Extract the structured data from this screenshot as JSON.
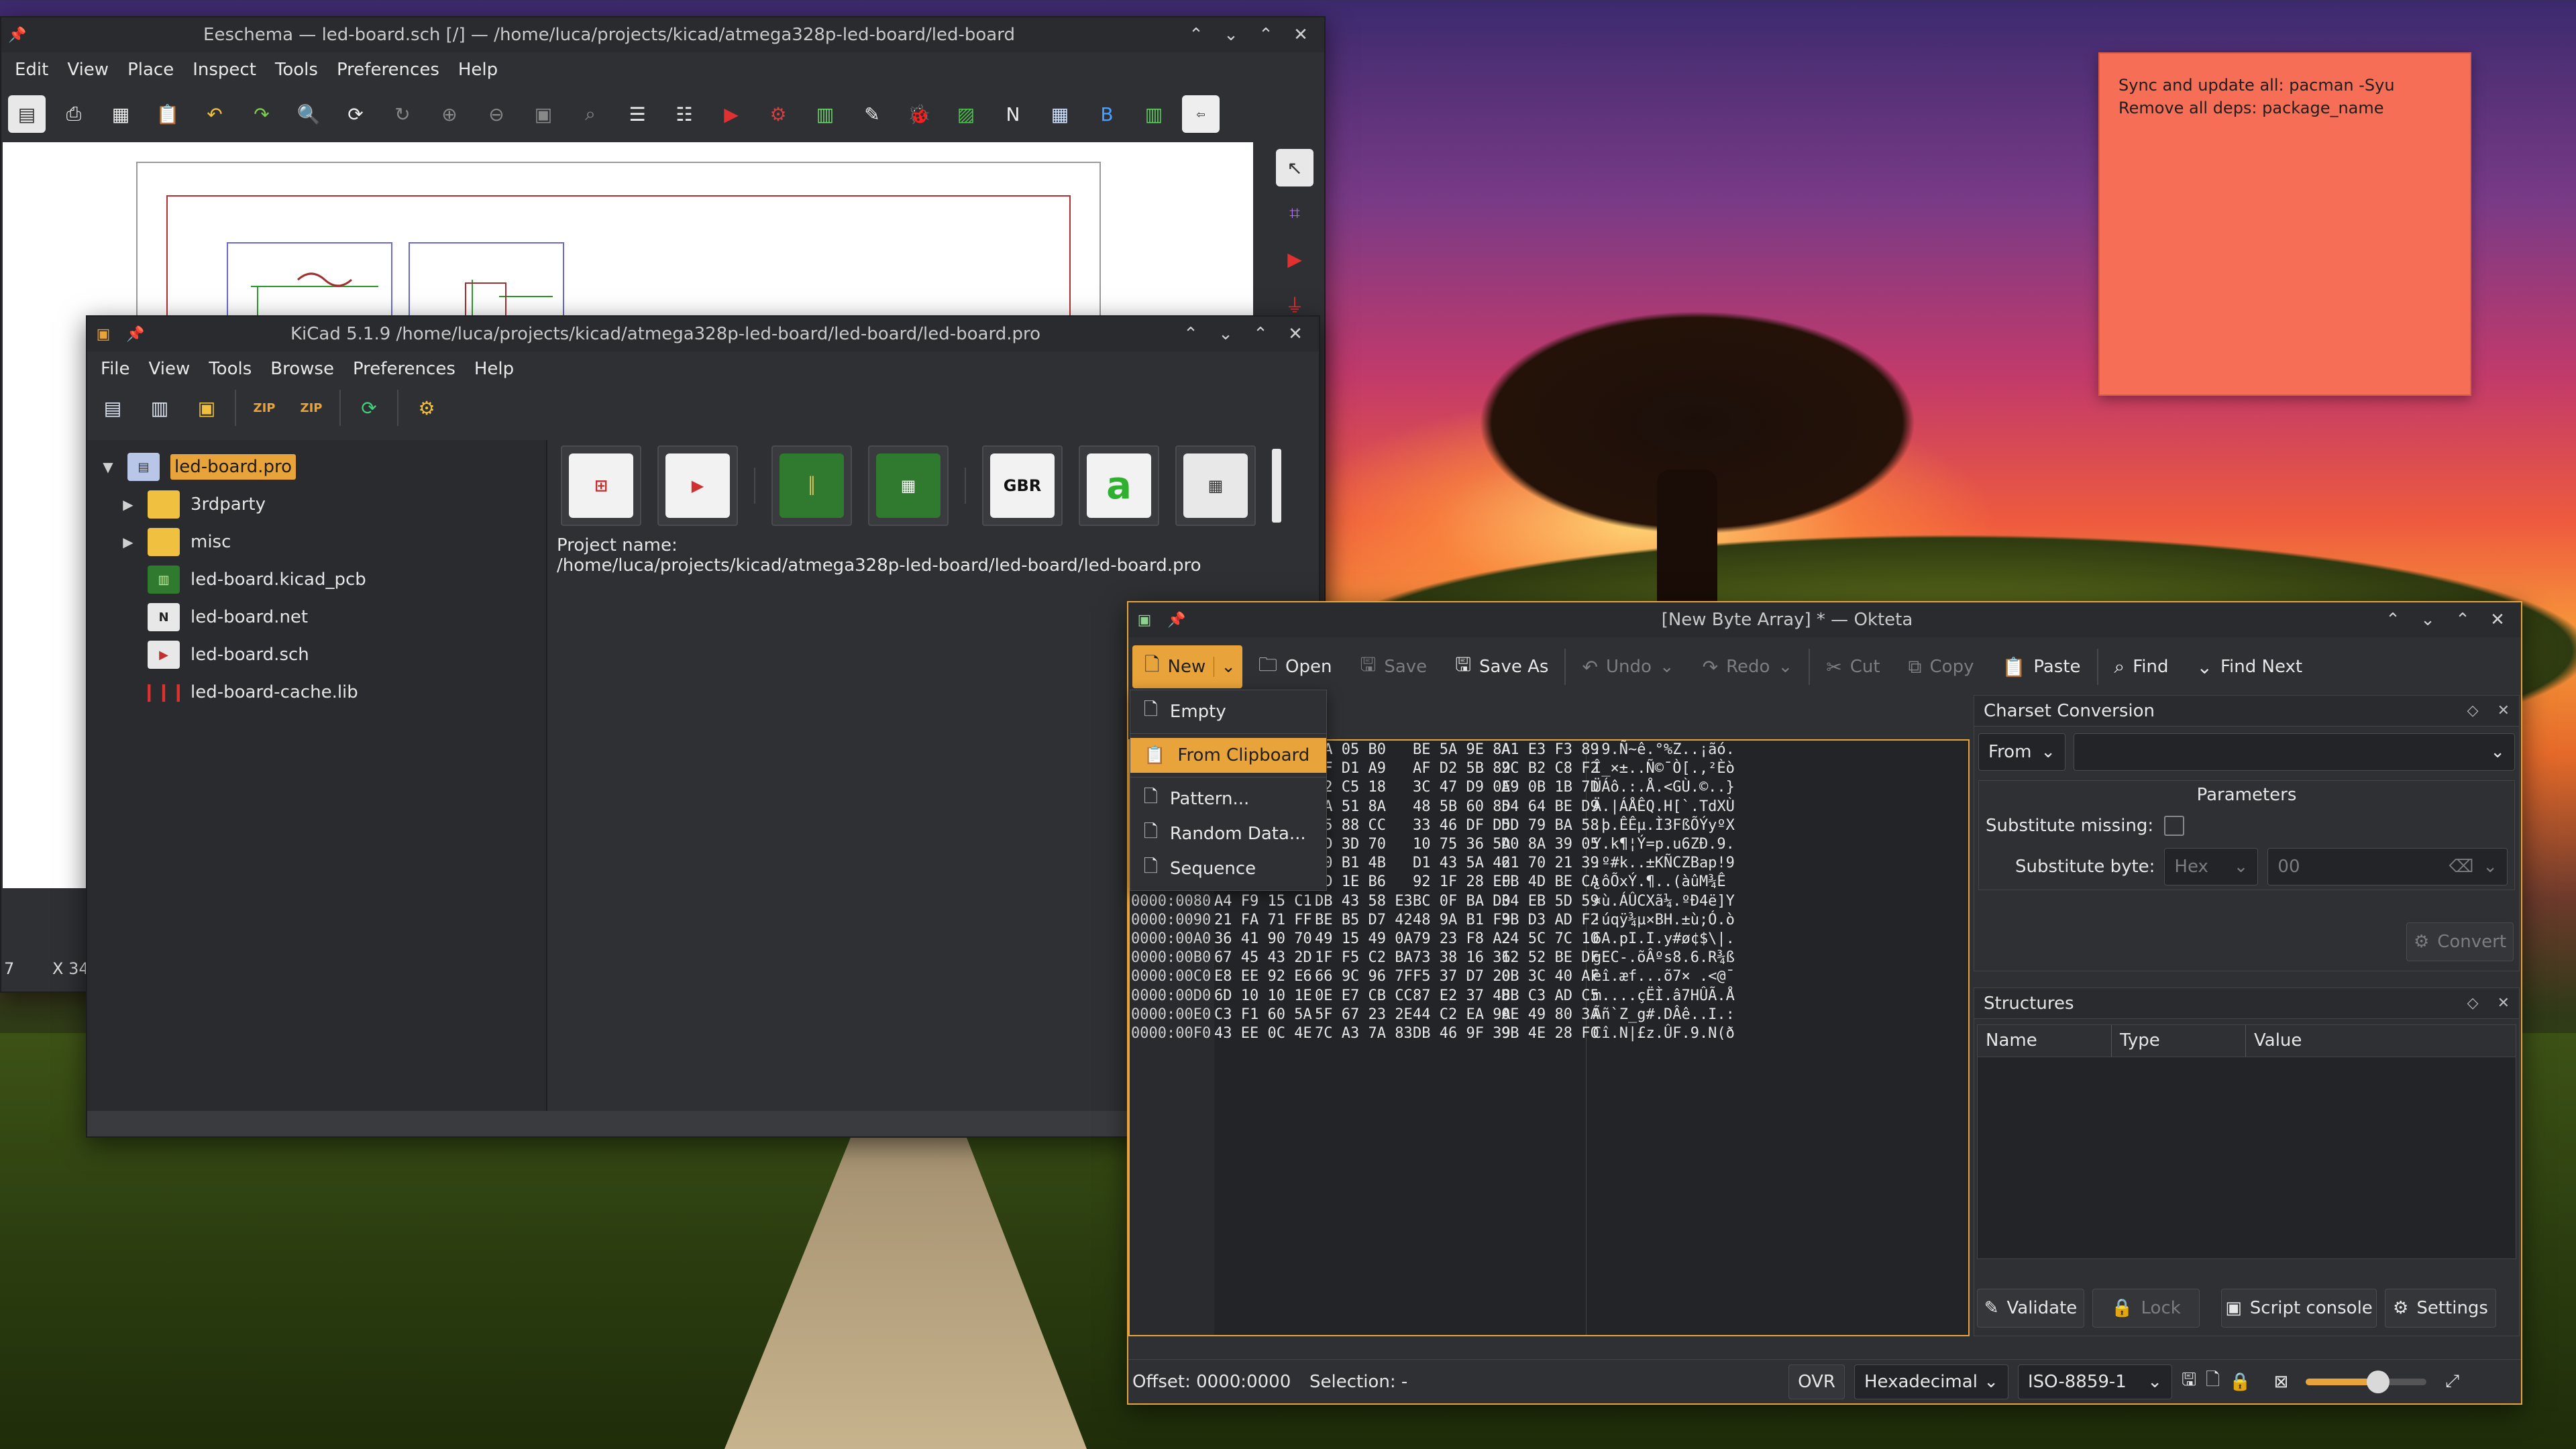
{
  "sticky_note": {
    "line1": "Sync and update all: pacman -Syu",
    "line2": "Remove all deps:  package_name"
  },
  "eeschema": {
    "title": "Eeschema — led-board.sch [/] — /home/luca/projects/kicad/atmega328p-led-board/led-board",
    "menu": [
      "Edit",
      "View",
      "Place",
      "Inspect",
      "Tools",
      "Preferences",
      "Help"
    ],
    "status_left": "7",
    "status_x": "X 34"
  },
  "kicad": {
    "title": "KiCad 5.1.9 /home/luca/projects/kicad/atmega328p-led-board/led-board/led-board.pro",
    "menu": [
      "File",
      "View",
      "Tools",
      "Browse",
      "Preferences",
      "Help"
    ],
    "tree": {
      "root": "led-board.pro",
      "items": [
        "3rdparty",
        "misc",
        "led-board.kicad_pcb",
        "led-board.net",
        "led-board.sch",
        "led-board-cache.lib"
      ]
    },
    "project_name_label": "Project name:",
    "project_path": "/home/luca/projects/kicad/atmega328p-led-board/led-board/led-board.pro"
  },
  "okteta": {
    "title": "[New Byte Array] * — Okteta",
    "toolbar": {
      "new": "New",
      "open": "Open",
      "save": "Save",
      "save_as": "Save As",
      "undo": "Undo",
      "redo": "Redo",
      "cut": "Cut",
      "copy": "Copy",
      "paste": "Paste",
      "find": "Find",
      "find_next": "Find Next"
    },
    "new_menu": [
      "Empty",
      "From Clipboard",
      "Pattern...",
      "Random Data...",
      "Sequence"
    ],
    "hex_rows": [
      {
        "off": "",
        "b1": "EA 05 B0",
        "b2": "BE 5A 9E 8A",
        "b3": "A1 E3 F3 89",
        "ch": ".9.Ñ~ê.°%Z..¡ãó."
      },
      {
        "off": "",
        "b1": "9F D1 A9",
        "b2": "AF D2 5B 89",
        "b3": "2C B2 C8 F2",
        "ch": "Î_×±..Ñ©¯Ò[.,²Èò"
      },
      {
        "off": "",
        "b1": "92 C5 18",
        "b2": "3C 47 D9 0E",
        "b3": "A9 0B 1B 7D",
        "ch": "ÜÁô.:.Å.<GÙ.©..}"
      },
      {
        "off": "",
        "b1": "CA 51 8A",
        "b2": "48 5B 60 8D",
        "b3": "54 64 BE D9",
        "ch": "Ä.|ÁÅÊQ.H[`.TdXÙ"
      },
      {
        "off": "",
        "b1": "B5 88 CC",
        "b2": "33 46 DF D5",
        "b3": "DD 79 BA 58",
        "ch": ".þ.ÊÊµ.Ì3FßÕÝyºX"
      },
      {
        "off": "",
        "b1": "DD 3D 70",
        "b2": "10 75 36 5A",
        "b3": "D0 8A 39 05",
        "ch": "Y.k¶¦Ý=p.u6ZÐ.9."
      },
      {
        "off": "",
        "b1": "10 B1 4B",
        "b2": "D1 43 5A 42",
        "b3": "61 70 21 39",
        "ch": ".º#k..±KÑCZBap!9"
      },
      {
        "off": "",
        "b1": "DD 1E B6",
        "b2": "92 1F 28 E0",
        "b3": "FB 4D BE CA",
        "ch": "¿ôÕxÝ.¶..(àûM¾Ê"
      },
      {
        "off": "0000:0080",
        "b0": "A4 F9 15 C1",
        "b1": "DB 43 58 E3",
        "b2": "BC 0F BA D0",
        "b3": "34 EB 5D 59",
        "ch": "¤ù.ÁÛCXã¼.ºÐ4ë]Y"
      },
      {
        "off": "0000:0090",
        "b0": "21 FA 71 FF",
        "b1": "BE B5 D7 42",
        "b2": "48 9A B1 F9",
        "b3": "3B D3 AD F2",
        "ch": "!úqÿ¾µ×BH.±ù;Ó.ò"
      },
      {
        "off": "0000:00A0",
        "b0": "36 41 90 70",
        "b1": "49 15 49 0A",
        "b2": "79 23 F8 A2",
        "b3": "24 5C 7C 10",
        "ch": "6A.pI.I.y#ø¢$\\|."
      },
      {
        "off": "0000:00B0",
        "b0": "67 45 43 2D",
        "b1": "1F F5 C2 BA",
        "b2": "73 38 16 36",
        "b3": "12 52 BE DF",
        "ch": "gEC-.õÂºs8.6.R¾ß"
      },
      {
        "off": "0000:00C0",
        "b0": "E8 EE 92 E6",
        "b1": "66 9C 96 7F",
        "b2": "F5 37 D7 20",
        "b3": "0B 3C 40 AF",
        "ch": "èî.æf...õ7× .<@¯"
      },
      {
        "off": "0000:00D0",
        "b0": "6D 10 10 1E",
        "b1": "0E E7 CB CC",
        "b2": "87 E2 37 48",
        "b3": "DB C3 AD C5",
        "ch": "m....çËÌ.â7HÛÃ.Å"
      },
      {
        "off": "0000:00E0",
        "b0": "C3 F1 60 5A",
        "b1": "5F 67 23 2E",
        "b2": "44 C2 EA 9A",
        "b3": "0E 49 80 3A",
        "ch": "Ãñ`Z_g#.DÂê..I.:"
      },
      {
        "off": "0000:00F0",
        "b0": "43 EE 0C 4E",
        "b1": "7C A3 7A 83",
        "b2": "DB 46 9F 39",
        "b3": "9B 4E 28 F0",
        "ch": "Cî.N|£z.ÛF.9.N(ð"
      }
    ],
    "charset": {
      "title": "Charset Conversion",
      "direction": "From",
      "charset_value": "",
      "params_title": "Parameters",
      "substitute_missing": "Substitute missing:",
      "substitute_byte": "Substitute byte:",
      "byte_format": "Hex",
      "byte_value": "00",
      "convert": "Convert"
    },
    "structures": {
      "title": "Structures",
      "columns": [
        "Name",
        "Type",
        "Value"
      ],
      "validate": "Validate",
      "lock": "Lock",
      "script_console": "Script console",
      "settings": "Settings"
    },
    "status": {
      "offset": "Offset: 0000:0000",
      "selection": "Selection: -",
      "ovr": "OVR",
      "coding": "Hexadecimal",
      "charset": "ISO-8859-1",
      "zoom": 0.6
    }
  }
}
